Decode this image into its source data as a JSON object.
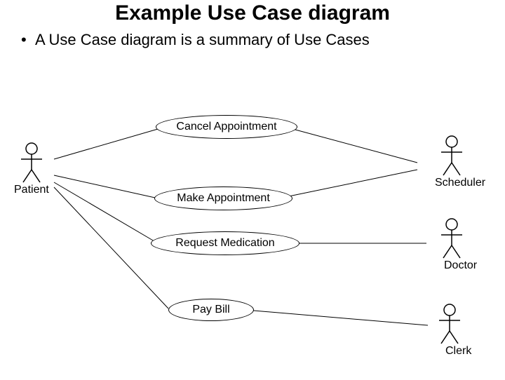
{
  "title": "Example Use Case diagram",
  "bullet": "A Use Case diagram is a summary of Use Cases",
  "actors": {
    "patient": "Patient",
    "scheduler": "Scheduler",
    "doctor": "Doctor",
    "clerk": "Clerk"
  },
  "usecases": {
    "cancel": "Cancel Appointment",
    "make": "Make Appointment",
    "request": "Request Medication",
    "pay": "Pay Bill"
  }
}
